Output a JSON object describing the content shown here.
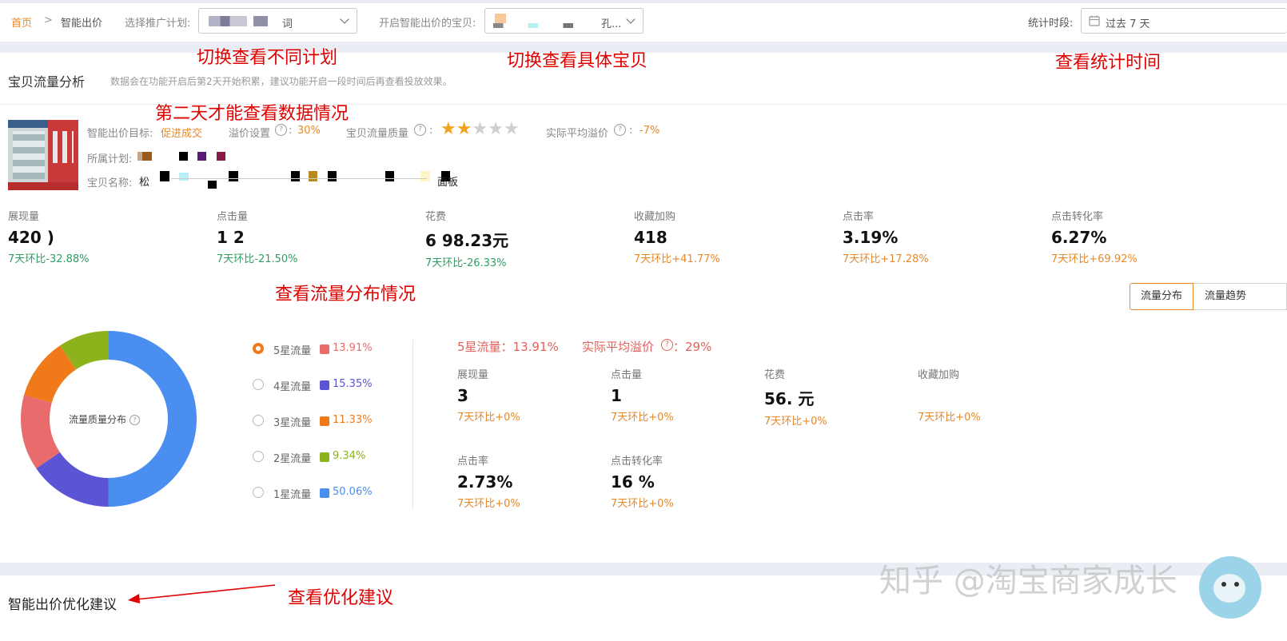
{
  "header": {
    "breadcrumb_home": "首页",
    "breadcrumb_sep": ">",
    "breadcrumb_current": "智能出价",
    "plan_label": "选择推广计划:",
    "plan_value": "词",
    "item_label": "开启智能出价的宝贝:",
    "item_value": "孔...",
    "period_label": "统计时段:",
    "period_value": "过去 7 天"
  },
  "annotations": {
    "switch_plan": "切换查看不同计划",
    "switch_item": "切换查看具体宝贝",
    "view_period": "查看统计时间",
    "second_day": "第二天才能查看数据情况",
    "view_distribution": "查看流量分布情况",
    "view_suggestion": "查看优化建议"
  },
  "section": {
    "title": "宝贝流量分析",
    "note": "数据会在功能开启后第2天开始积累，建议功能开启一段时间后再查看投放效果。"
  },
  "item": {
    "goal_label": "智能出价目标:",
    "goal_value": "促进成交",
    "premium_label": "溢价设置",
    "premium_value": "30%",
    "quality_label": "宝贝流量质量",
    "quality_stars": 2,
    "quality_max": 5,
    "avg_premium_label": "实际平均溢价",
    "avg_premium_value": "-7%",
    "plan_label": "所属计划:",
    "name_label": "宝贝名称:",
    "name_start": "松",
    "name_end": "面板",
    "colon": ":"
  },
  "metrics": [
    {
      "label": "展现量",
      "value": "420 )",
      "change": "7天环比-32.88%",
      "trend": "down"
    },
    {
      "label": "点击量",
      "value": "1  2",
      "change": "7天环比-21.50%",
      "trend": "down"
    },
    {
      "label": "花费",
      "value": "6  98.23元",
      "change": "7天环比-26.33%",
      "trend": "down"
    },
    {
      "label": "收藏加购",
      "value": "418",
      "change": "7天环比+41.77%",
      "trend": "up"
    },
    {
      "label": "点击率",
      "value": "3.19%",
      "change": "7天环比+17.28%",
      "trend": "up"
    },
    {
      "label": "点击转化率",
      "value": "6.27%",
      "change": "7天环比+69.92%",
      "trend": "up"
    }
  ],
  "tabs": {
    "distribution": "流量分布",
    "trend": "流量趋势"
  },
  "donut": {
    "center_label": "流量质量分布",
    "help_glyph": "?",
    "legend": [
      {
        "name": "5星流量",
        "pct": "13.91%",
        "value": 13.91,
        "color": "#ea6b6b",
        "selected": true
      },
      {
        "name": "4星流量",
        "pct": "15.35%",
        "value": 15.35,
        "color": "#5b55d6",
        "selected": false
      },
      {
        "name": "3星流量",
        "pct": "11.33%",
        "value": 11.33,
        "color": "#f07a1a",
        "selected": false
      },
      {
        "name": "2星流量",
        "pct": "9.34%",
        "value": 9.34,
        "color": "#8db31c",
        "selected": false
      },
      {
        "name": "1星流量",
        "pct": "50.06%",
        "value": 50.06,
        "color": "#4a8ef0",
        "selected": false
      }
    ]
  },
  "detail": {
    "heading": "5星流量：13.91%",
    "avg_premium": "实际平均溢价",
    "avg_premium_value": "：29%",
    "metrics": [
      {
        "label": "展现量",
        "value": "3",
        "change": "7天环比+0%"
      },
      {
        "label": "点击量",
        "value": "1",
        "change": "7天环比+0%"
      },
      {
        "label": "花费",
        "value": "56.  元",
        "change": "7天环比+0%"
      },
      {
        "label": "收藏加购",
        "value": "",
        "change": "7天环比+0%"
      },
      {
        "label": "点击率",
        "value": "2.73%",
        "change": "7天环比+0%"
      },
      {
        "label": "点击转化率",
        "value": "16  %",
        "change": "7天环比+0%"
      }
    ]
  },
  "footer": {
    "title": "智能出价优化建议",
    "watermark": "知乎 @淘宝商家成长"
  },
  "colors": {
    "accent": "#e6892a",
    "green": "#2f9d62",
    "annotation": "#e00000",
    "pink": "#e0605a"
  }
}
